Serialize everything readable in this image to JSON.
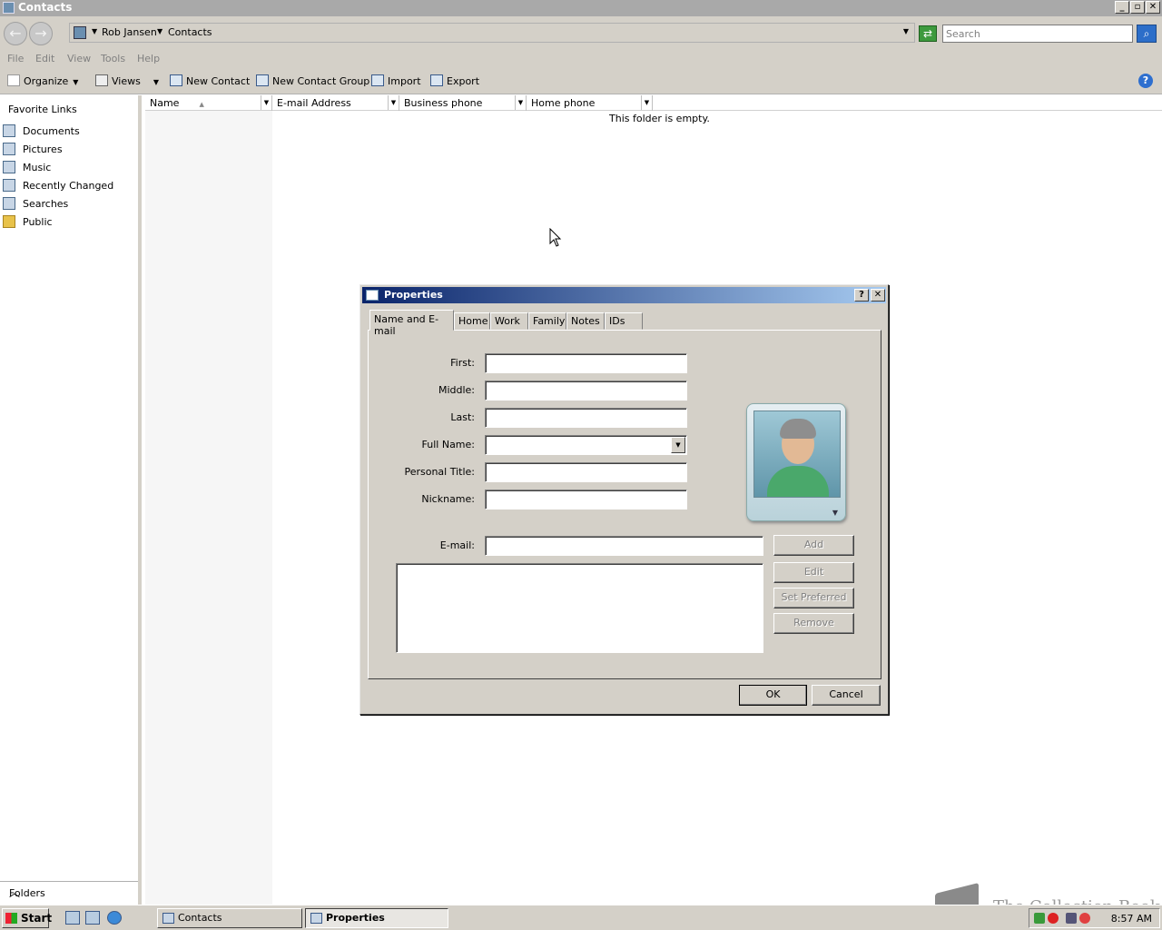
{
  "window": {
    "title": "Contacts",
    "controls": {
      "minimize": "_",
      "maximize": "▫",
      "close": "✕"
    }
  },
  "address": {
    "crumbs": [
      "Rob Jansen",
      "Contacts"
    ],
    "search_placeholder": "Search"
  },
  "menu": [
    "File",
    "Edit",
    "View",
    "Tools",
    "Help"
  ],
  "toolbar": {
    "organize": "Organize",
    "views": "Views",
    "new_contact": "New Contact",
    "new_contact_group": "New Contact Group",
    "import": "Import",
    "export": "Export",
    "help": "?"
  },
  "nav": {
    "favorites_title": "Favorite Links",
    "items": [
      "Documents",
      "Pictures",
      "Music",
      "Recently Changed",
      "Searches",
      "Public"
    ],
    "folders": "Folders"
  },
  "list": {
    "columns": [
      "Name",
      "E-mail Address",
      "Business phone",
      "Home phone"
    ],
    "empty_text": "This folder is empty."
  },
  "dialog": {
    "title": "Properties",
    "help_btn": "?",
    "close_btn": "✕",
    "tabs": [
      "Name and E-mail",
      "Home",
      "Work",
      "Family",
      "Notes",
      "IDs"
    ],
    "active_tab": "Name and E-mail",
    "fields": {
      "first_label": "First:",
      "middle_label": "Middle:",
      "last_label": "Last:",
      "fullname_label": "Full Name:",
      "title_label": "Personal Title:",
      "nickname_label": "Nickname:",
      "email_label": "E-mail:"
    },
    "buttons": {
      "add": "Add",
      "edit": "Edit",
      "set_preferred": "Set Preferred",
      "remove": "Remove",
      "ok": "OK",
      "cancel": "Cancel"
    }
  },
  "taskbar": {
    "start": "Start",
    "tasks": [
      "Contacts",
      "Properties"
    ],
    "active_task": "Properties",
    "clock": "8:57 AM"
  },
  "watermark": "The Collection Book"
}
